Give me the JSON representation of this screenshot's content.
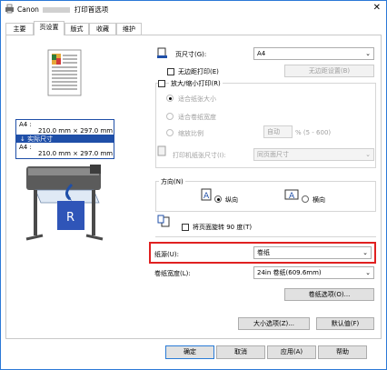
{
  "window": {
    "title_prefix": "Canon",
    "title_suffix": "打印首选项",
    "close_glyph": "✕"
  },
  "tabs": [
    {
      "label": "主要"
    },
    {
      "label": "页设置"
    },
    {
      "label": "版式"
    },
    {
      "label": "收藏"
    },
    {
      "label": "维护"
    }
  ],
  "preview": {
    "size_line1_label": "A4 :",
    "size_line1_value": "210.0 mm × 297.0 mm",
    "arrow_label": "↓ 实际尺寸",
    "size_line2_label": "A4 :",
    "size_line2_value": "210.0 mm × 297.0 mm"
  },
  "page_size": {
    "label": "页尺寸(G):",
    "value": "A4"
  },
  "borderless": {
    "label": "无边距打印(E)",
    "button": "无边距设置(B)"
  },
  "scale": {
    "group_label": "放大/缩小打印(R)",
    "fit_paper": "适合纸张大小",
    "fit_roll": "适合卷纸宽度",
    "ratio_label": "缩放比例",
    "ratio_value": "自动",
    "ratio_range": "% (5 - 600)",
    "printer_paper_label": "打印机纸张尺寸(I):",
    "printer_paper_value": "同页面尺寸"
  },
  "orientation": {
    "group_label": "方向(N)",
    "portrait": "纵向",
    "landscape": "横向"
  },
  "rotate": {
    "label": "将页面旋转 90 度(T)"
  },
  "paper_source": {
    "label": "纸源(U):",
    "value": "卷纸"
  },
  "roll_width": {
    "label": "卷纸宽度(L):",
    "value": "24in 卷纸(609.6mm)"
  },
  "buttons": {
    "roll_options": "卷纸选项(O)...",
    "size_options": "大小选项(Z)...",
    "defaults": "默认值(F)",
    "ok": "确定",
    "cancel": "取消",
    "apply": "应用(A)",
    "help": "帮助"
  },
  "colors": {
    "highlight": "#e02020",
    "accent": "#2a7bd6",
    "preview_blue": "#1f4fa8"
  }
}
